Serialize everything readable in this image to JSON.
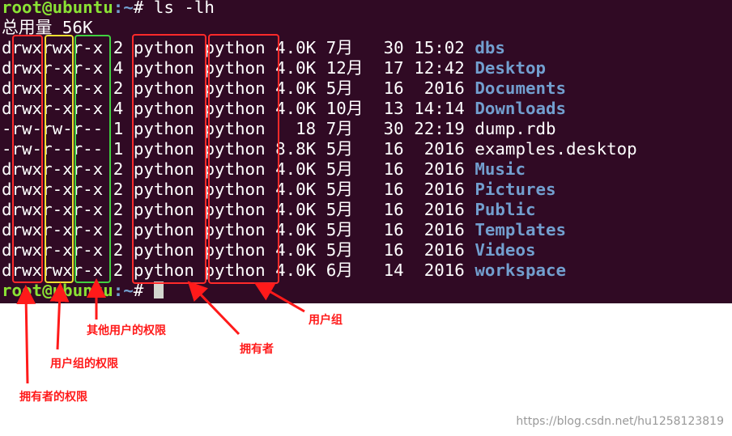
{
  "terminal": {
    "prompt": {
      "user": "root@ubuntu",
      "path": ":~",
      "symbol": "# "
    },
    "command": "ls -lh",
    "total": "总用量 56K",
    "entries": [
      {
        "perm": "drwxrwxr-x",
        "links": "2",
        "owner": "python",
        "group": "python",
        "size": "4.0K",
        "month": "7月",
        "day": "30",
        "time": "15:02",
        "name": "dbs",
        "is_dir": true
      },
      {
        "perm": "drwxr-xr-x",
        "links": "4",
        "owner": "python",
        "group": "python",
        "size": "4.0K",
        "month": "12月",
        "day": "17",
        "time": "12:42",
        "name": "Desktop",
        "is_dir": true
      },
      {
        "perm": "drwxr-xr-x",
        "links": "2",
        "owner": "python",
        "group": "python",
        "size": "4.0K",
        "month": "5月",
        "day": "16",
        "time": "2016",
        "name": "Documents",
        "is_dir": true
      },
      {
        "perm": "drwxr-xr-x",
        "links": "4",
        "owner": "python",
        "group": "python",
        "size": "4.0K",
        "month": "10月",
        "day": "13",
        "time": "14:14",
        "name": "Downloads",
        "is_dir": true
      },
      {
        "perm": "-rw-rw-r--",
        "links": "1",
        "owner": "python",
        "group": "python",
        "size": "18",
        "month": "7月",
        "day": "30",
        "time": "22:19",
        "name": "dump.rdb",
        "is_dir": false
      },
      {
        "perm": "-rw-r--r--",
        "links": "1",
        "owner": "python",
        "group": "python",
        "size": "8.8K",
        "month": "5月",
        "day": "16",
        "time": "2016",
        "name": "examples.desktop",
        "is_dir": false
      },
      {
        "perm": "drwxr-xr-x",
        "links": "2",
        "owner": "python",
        "group": "python",
        "size": "4.0K",
        "month": "5月",
        "day": "16",
        "time": "2016",
        "name": "Music",
        "is_dir": true
      },
      {
        "perm": "drwxr-xr-x",
        "links": "2",
        "owner": "python",
        "group": "python",
        "size": "4.0K",
        "month": "5月",
        "day": "16",
        "time": "2016",
        "name": "Pictures",
        "is_dir": true
      },
      {
        "perm": "drwxr-xr-x",
        "links": "2",
        "owner": "python",
        "group": "python",
        "size": "4.0K",
        "month": "5月",
        "day": "16",
        "time": "2016",
        "name": "Public",
        "is_dir": true
      },
      {
        "perm": "drwxr-xr-x",
        "links": "2",
        "owner": "python",
        "group": "python",
        "size": "4.0K",
        "month": "5月",
        "day": "16",
        "time": "2016",
        "name": "Templates",
        "is_dir": true
      },
      {
        "perm": "drwxr-xr-x",
        "links": "2",
        "owner": "python",
        "group": "python",
        "size": "4.0K",
        "month": "5月",
        "day": "16",
        "time": "2016",
        "name": "Videos",
        "is_dir": true
      },
      {
        "perm": "drwxrwxr-x",
        "links": "2",
        "owner": "python",
        "group": "python",
        "size": "4.0K",
        "month": "6月",
        "day": "14",
        "time": "2016",
        "name": "workspace",
        "is_dir": true
      }
    ]
  },
  "annotations": {
    "other_perm": "其他用户的权限",
    "group_perm": "用户组的权限",
    "owner_perm": "拥有者的权限",
    "owner": "拥有者",
    "group": "用户组"
  },
  "colors": {
    "background": "#300a24",
    "prompt_user": "#8ae234",
    "directory": "#729fcf",
    "annotation": "#ff1a1a",
    "box_owner": "#ff2a2a",
    "box_group_perm": "#f0e030",
    "box_other_perm": "#40d040"
  },
  "watermark": "https://blog.csdn.net/hu1258123819"
}
